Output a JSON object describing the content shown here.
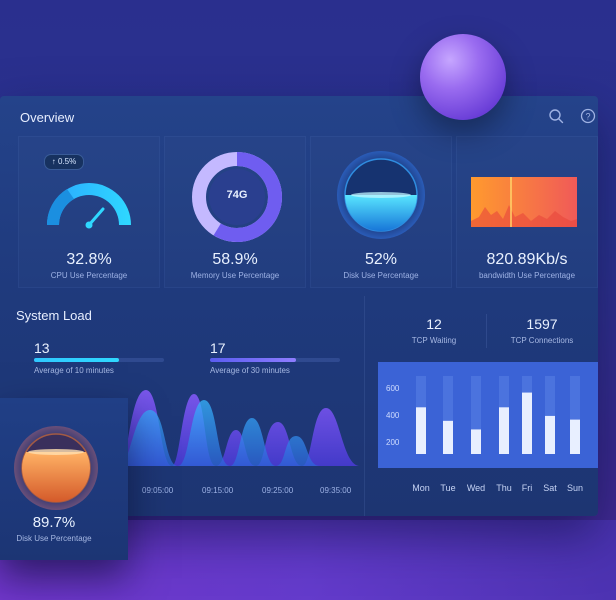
{
  "overview": {
    "title": "Overview",
    "header_icons": [
      "search-icon",
      "help-icon"
    ]
  },
  "metrics": [
    {
      "id": "cpu",
      "value": "32.8%",
      "label": "CPU Use Percentage",
      "badge": "↑ 0.5%",
      "icon": "gauge-icon"
    },
    {
      "id": "memory",
      "value": "58.9%",
      "label": "Memory Use Percentage",
      "center": "74G",
      "icon": "donut-icon"
    },
    {
      "id": "disk",
      "value": "52%",
      "label": "Disk Use Percentage",
      "icon": "liquid-sphere-icon"
    },
    {
      "id": "bandwidth",
      "value": "820.89Kb/s",
      "label": "bandwidth Use Percentage",
      "icon": "bandwidth-chart-icon"
    }
  ],
  "system_load": {
    "title": "System Load",
    "avg10": {
      "value": "13",
      "label": "Average of 10 minutes",
      "fill": 0.65
    },
    "avg30": {
      "value": "17",
      "label": "Average of 30 minutes",
      "fill": 0.66
    },
    "time_labels": [
      "09:05:00",
      "09:15:00",
      "09:25:00",
      "09:35:00"
    ]
  },
  "tcp": {
    "waiting": {
      "value": "12",
      "label": "TCP Waiting"
    },
    "connections": {
      "value": "1597",
      "label": "TCP Connections"
    }
  },
  "chart_data": {
    "type": "bar",
    "categories": [
      "Mon",
      "Tue",
      "Wed",
      "Thu",
      "Fri",
      "Sat",
      "Sun"
    ],
    "values": [
      380,
      270,
      200,
      380,
      500,
      310,
      280
    ],
    "yticks": [
      "600",
      "400",
      "200"
    ],
    "ylim": [
      0,
      700
    ]
  },
  "disk_popup": {
    "value": "89.7%",
    "label": "Disk Use Percentage"
  },
  "colors": {
    "accent_cyan": "#2fd2ff",
    "accent_purple": "#7e6cff",
    "accent_orange": "#ff8a3a"
  }
}
